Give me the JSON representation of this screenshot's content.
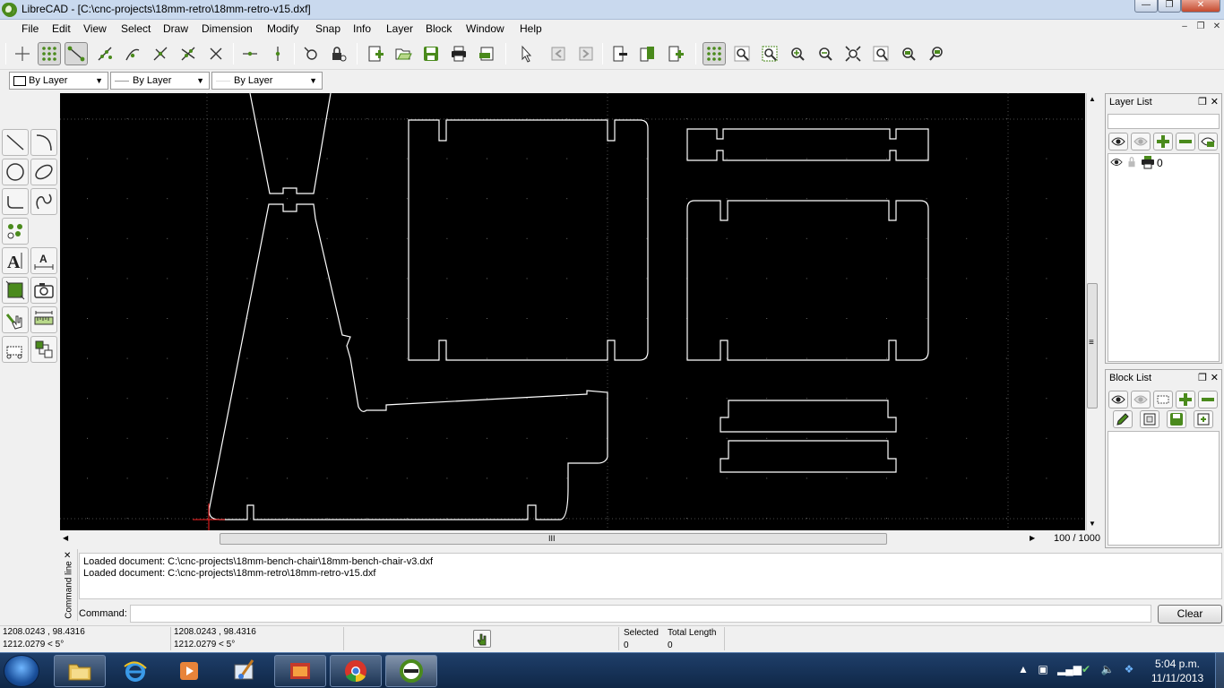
{
  "window": {
    "title": "LibreCAD - [C:\\cnc-projects\\18mm-retro\\18mm-retro-v15.dxf]",
    "min_label": "—",
    "max_label": "❐",
    "close_label": "✕"
  },
  "menu": {
    "items": [
      "File",
      "Edit",
      "View",
      "Select",
      "Draw",
      "Dimension",
      "Modify",
      "Snap",
      "Info",
      "Layer",
      "Block",
      "Window",
      "Help"
    ],
    "mdi_min": "–",
    "mdi_restore": "❐",
    "mdi_close": "✕"
  },
  "pen_toolbar": {
    "color": "By Layer",
    "width": "By Layer",
    "linetype": "By Layer"
  },
  "layer_list": {
    "title": "Layer List",
    "layers": [
      {
        "name": "0"
      }
    ]
  },
  "block_list": {
    "title": "Block List"
  },
  "dock_controls": {
    "float": "❐",
    "close": "✕"
  },
  "drawing": {
    "grid_label": "100 / 1000",
    "hscroll_grip": "III",
    "vscroll_grip": "≡"
  },
  "command": {
    "side_title": "Command line",
    "history": [
      "Loaded document: C:\\cnc-projects\\18mm-bench-chair\\18mm-bench-chair-v3.dxf",
      "Loaded document: C:\\cnc-projects\\18mm-retro\\18mm-retro-v15.dxf"
    ],
    "label": "Command:",
    "input_value": "",
    "clear_label": "Clear"
  },
  "status": {
    "abs_coord": "1208.0243 , 98.4316",
    "abs_polar": "1212.0279 < 5°",
    "rel_coord": "1208.0243 , 98.4316",
    "rel_polar": "1212.0279 < 5°",
    "selected_label": "Selected",
    "selected_value": "0",
    "length_label": "Total Length",
    "length_value": "0"
  },
  "taskbar": {
    "time": "5:04 p.m.",
    "date": "11/11/2013"
  },
  "colors": {
    "accent_green": "#4a8a1c",
    "canvas_bg": "#000000",
    "entity": "#ffffff"
  }
}
